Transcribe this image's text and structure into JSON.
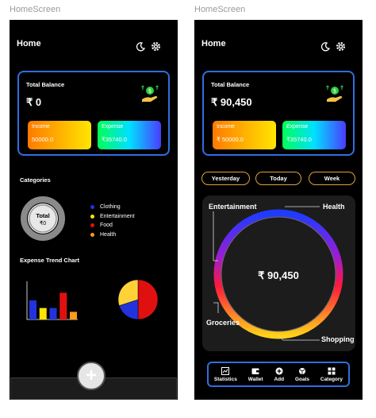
{
  "frames": [
    {
      "label": "HomeScreen"
    },
    {
      "label": "HomeScreen"
    }
  ],
  "screen1": {
    "header": {
      "title": "Home"
    },
    "balance": {
      "label": "Total Balance",
      "value": "₹ 0"
    },
    "income": {
      "label": "Income",
      "value": "50000.0"
    },
    "expense": {
      "label": "Expense",
      "value": "₹35740.0"
    },
    "categories": {
      "title": "Categories",
      "donut_label_line1": "Total",
      "donut_label_line2": "₹0",
      "items": [
        {
          "label": "Clothing",
          "color": "#2233dd"
        },
        {
          "label": "Entertainment",
          "color": "#ffe600"
        },
        {
          "label": "Food",
          "color": "#e01010"
        },
        {
          "label": "Health",
          "color": "#ff9a1a"
        }
      ]
    },
    "trend": {
      "title": "Expense Trend Chart"
    },
    "fab_label": "+"
  },
  "screen2": {
    "header": {
      "title": "Home"
    },
    "balance": {
      "label": "Total Balance",
      "value": "₹ 90,450"
    },
    "income": {
      "label": "Income",
      "value": "₹ 50000.0"
    },
    "expense": {
      "label": "Expense",
      "value": "₹35740.0"
    },
    "filters": [
      {
        "label": "Yesterday"
      },
      {
        "label": "Today"
      },
      {
        "label": "Week"
      }
    ],
    "ring": {
      "center": "₹ 90,450",
      "labels": {
        "entertainment": "Entertainment",
        "health": "Health",
        "groceries": "Groceries",
        "shopping": "Shopping"
      }
    },
    "nav": [
      {
        "label": "Statistics",
        "icon": "statistics-icon"
      },
      {
        "label": "Wallet",
        "icon": "wallet-icon"
      },
      {
        "label": "Add",
        "icon": "add-icon"
      },
      {
        "label": "Goals",
        "icon": "goals-icon"
      },
      {
        "label": "Category",
        "icon": "category-icon"
      }
    ]
  },
  "chart_data": [
    {
      "type": "bar",
      "categories": [
        "",
        "",
        "",
        "",
        ""
      ],
      "values": [
        5,
        3,
        3,
        7,
        2
      ],
      "colors": [
        "#2233dd",
        "#ffe600",
        "#2233dd",
        "#e01010",
        "#ff9a1a"
      ],
      "ylim": [
        0,
        10
      ],
      "grid": false
    },
    {
      "type": "pie",
      "values": [
        50,
        20,
        30
      ],
      "colors": [
        "#e01010",
        "#2233dd",
        "#ffd23a"
      ]
    }
  ]
}
